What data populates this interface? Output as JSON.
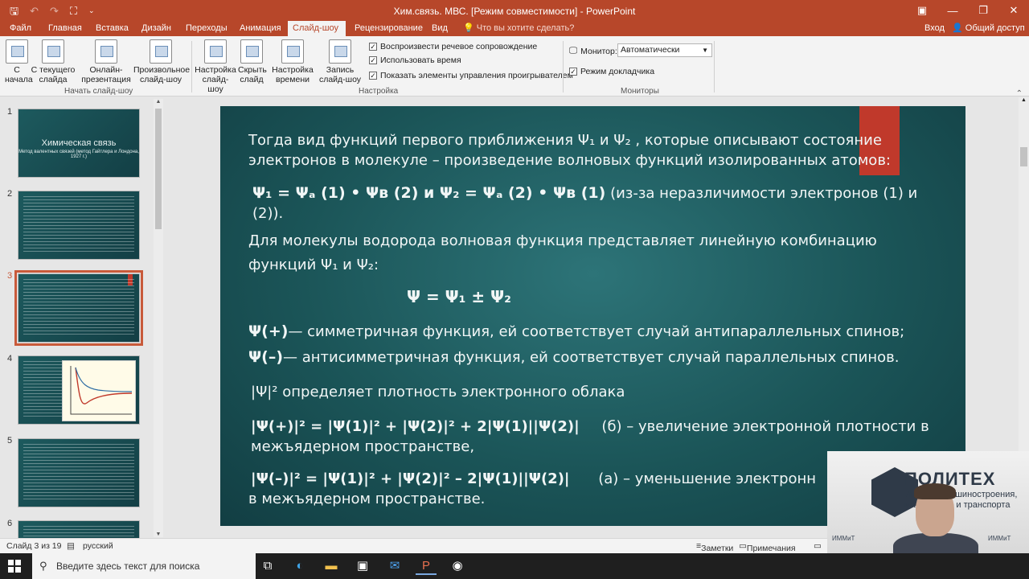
{
  "window": {
    "title": "Хим.связь. МВС. [Режим совместимости] - PowerPoint"
  },
  "tabs": [
    {
      "label": "Файл"
    },
    {
      "label": "Главная"
    },
    {
      "label": "Вставка"
    },
    {
      "label": "Дизайн"
    },
    {
      "label": "Переходы"
    },
    {
      "label": "Анимация"
    },
    {
      "label": "Слайд-шоу"
    },
    {
      "label": "Рецензирование"
    },
    {
      "label": "Вид"
    }
  ],
  "tellme": "Что вы хотите сделать?",
  "account": {
    "signin": "Вход",
    "share": "Общий доступ"
  },
  "ribbon": {
    "buttons": [
      {
        "label": "С начала"
      },
      {
        "label": "С текущего слайда"
      },
      {
        "label": "Онлайн-презентация"
      },
      {
        "label": "Произвольное слайд-шоу"
      },
      {
        "label": "Настройка слайд-шоу"
      },
      {
        "label": "Скрыть слайд"
      },
      {
        "label": "Настройка времени"
      },
      {
        "label": "Запись слайд-шоу"
      }
    ],
    "groups": {
      "start": "Начать слайд-шоу",
      "setup": "Настройка",
      "monitors": "Мониторы"
    },
    "checks": [
      {
        "label": "Воспроизвести речевое сопровождение",
        "checked": true
      },
      {
        "label": "Использовать время",
        "checked": true
      },
      {
        "label": "Показать элементы управления проигрывателем",
        "checked": true
      }
    ],
    "monitor_label": "Монитор:",
    "monitor_value": "Автоматически",
    "presenter_view": "Режим докладчика"
  },
  "thumbnails": [
    {
      "num": "1",
      "title": "Химическая связь",
      "subtitle": "Метод валентных связей (метод Гайтлера и Лондона, 1927 г.)"
    },
    {
      "num": "2"
    },
    {
      "num": "3",
      "selected": true
    },
    {
      "num": "4"
    },
    {
      "num": "5"
    },
    {
      "num": "6"
    }
  ],
  "slide": {
    "p1": "Тогда вид функций первого приближения Ψ₁ и Ψ₂ , которые описывают состояние электронов в молекуле – произведение волновых функций изолированных атомов:",
    "p2_formula": "Ψ₁ = Ψₐ (1) • Ψв (2) и Ψ₂ = Ψₐ (2) • Ψв (1)",
    "p2_rest": " (из-за неразличимости электронов (1) и (2)).",
    "p3": "Для молекулы водорода волновая функция представляет линейную комбинацию функций Ψ₁ и Ψ₂:",
    "p4": "Ψ = Ψ₁ ± Ψ₂",
    "p5_sym": "Ψ(+)",
    "p5": "— симметричная функция, ей соответствует случай антипараллельных спинов;",
    "p6_sym": "Ψ(–)",
    "p6": "— антисимметричная функция, ей соответствует случай параллельных спинов.",
    "p7_sym": "|Ψ|²",
    "p7": " определяет плотность электронного облака",
    "p8_formula": "|Ψ(+)|² = |Ψ(1)|² + |Ψ(2)|² + 2|Ψ(1)||Ψ(2)|",
    "p8_rest": "(б) – увеличение электронной плотности в межъядерном пространстве,",
    "p9_formula": "|Ψ(–)|² = |Ψ(1)|² + |Ψ(2)|² – 2|Ψ(1)||Ψ(2)|",
    "p9_rest": "(а) – уменьшение электронн",
    "p9_line2": "в межъядерном пространстве."
  },
  "status": {
    "slide": "Слайд 3 из 19",
    "lang": "русский",
    "notes": "Заметки",
    "comments": "Примечания"
  },
  "webcam": {
    "brand": "ПОЛИТЕХ",
    "sub": "Институт машиностроения, материалов и транспорта",
    "tag": "ИММиТ"
  },
  "taskbar": {
    "search_placeholder": "Введите здесь текст для поиска"
  }
}
